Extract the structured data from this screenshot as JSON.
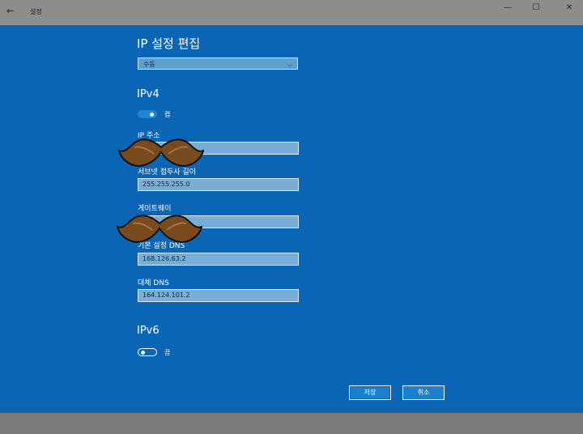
{
  "window": {
    "back_icon": "back-arrow-icon",
    "title": "설정",
    "controls": {
      "minimize": "—",
      "maximize": "☐",
      "close": "✕"
    }
  },
  "dialog": {
    "title": "IP 설정 편집",
    "mode_select": {
      "value": "수동"
    },
    "ipv4": {
      "heading": "IPv4",
      "toggle": {
        "state": "on",
        "label": "켬"
      },
      "fields": [
        {
          "label": "IP 주소",
          "value": ""
        },
        {
          "label": "서브넷 접두사 길이",
          "value": "255.255.255.0"
        },
        {
          "label": "게이트웨이",
          "value": ""
        },
        {
          "label": "기본 설정 DNS",
          "value": "168.126.63.2"
        },
        {
          "label": "대체 DNS",
          "value": "164.124.101.2"
        }
      ]
    },
    "ipv6": {
      "heading": "IPv6",
      "toggle": {
        "state": "off",
        "label": "끔"
      }
    },
    "buttons": {
      "save": "저장",
      "cancel": "취소"
    }
  },
  "colors": {
    "dialog_bg": "#0a66b4",
    "toggle_on": "#1b86d6",
    "overlay_mustache": "#7a4a1f"
  }
}
